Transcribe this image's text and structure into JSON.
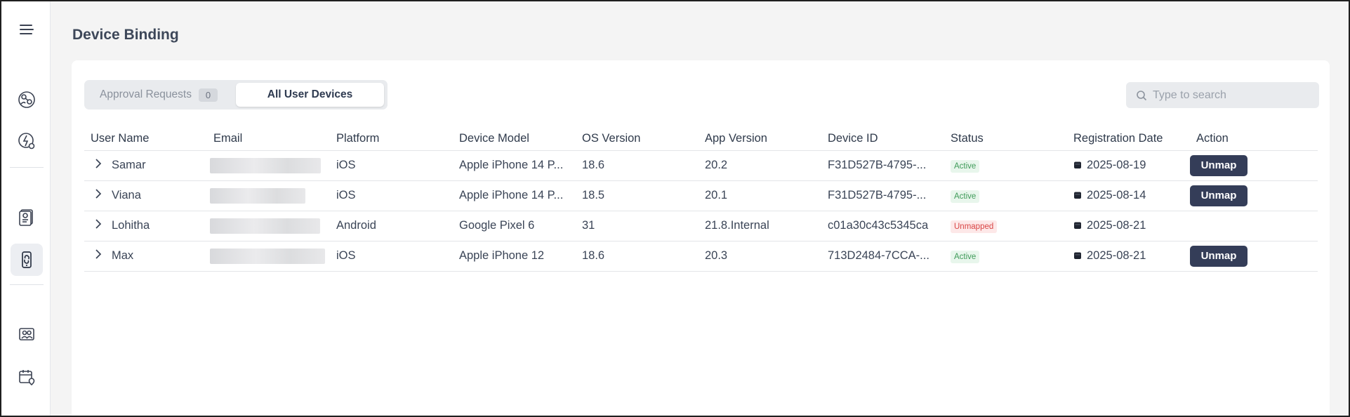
{
  "page": {
    "title": "Device Binding"
  },
  "sidebar": {
    "items": [
      {
        "icon": "location-network-icon"
      },
      {
        "icon": "lightning-location-icon"
      },
      {
        "icon": "report-document-icon"
      },
      {
        "icon": "device-link-icon",
        "active": true
      },
      {
        "icon": "team-users-icon"
      },
      {
        "icon": "calendar-location-icon"
      }
    ]
  },
  "tabs": {
    "approval_label": "Approval Requests",
    "approval_count": "0",
    "all_devices_label": "All User Devices"
  },
  "search": {
    "placeholder": "Type to search"
  },
  "table": {
    "headers": {
      "user_name": "User Name",
      "email": "Email",
      "platform": "Platform",
      "device_model": "Device Model",
      "os_version": "OS Version",
      "app_version": "App Version",
      "device_id": "Device ID",
      "status": "Status",
      "registration_date": "Registration Date",
      "action": "Action"
    },
    "rows": [
      {
        "user": "Samar",
        "platform": "iOS",
        "model": "Apple iPhone 14 P...",
        "os": "18.6",
        "app": "20.2",
        "device_id": "F31D527B-4795-...",
        "status": "Active",
        "date": "2025-08-19",
        "action": "Unmap"
      },
      {
        "user": "Viana",
        "platform": "iOS",
        "model": "Apple iPhone 14 P...",
        "os": "18.5",
        "app": "20.1",
        "device_id": "F31D527B-4795-...",
        "status": "Active",
        "date": "2025-08-14",
        "action": "Unmap"
      },
      {
        "user": "Lohitha",
        "platform": "Android",
        "model": "Google Pixel 6",
        "os": "31",
        "app": "21.8.Internal",
        "device_id": "c01a30c43c5345ca",
        "status": "Unmapped",
        "date": "2025-08-21",
        "action": ""
      },
      {
        "user": "Max",
        "platform": "iOS",
        "model": "Apple iPhone 12",
        "os": "18.6",
        "app": "20.3",
        "device_id": "713D2484-7CCA-...",
        "status": "Active",
        "date": "2025-08-21",
        "action": "Unmap"
      }
    ]
  },
  "colors": {
    "primary_button": "#343d58",
    "active_badge_text": "#3f9b59",
    "unmapped_badge_text": "#d94545"
  }
}
